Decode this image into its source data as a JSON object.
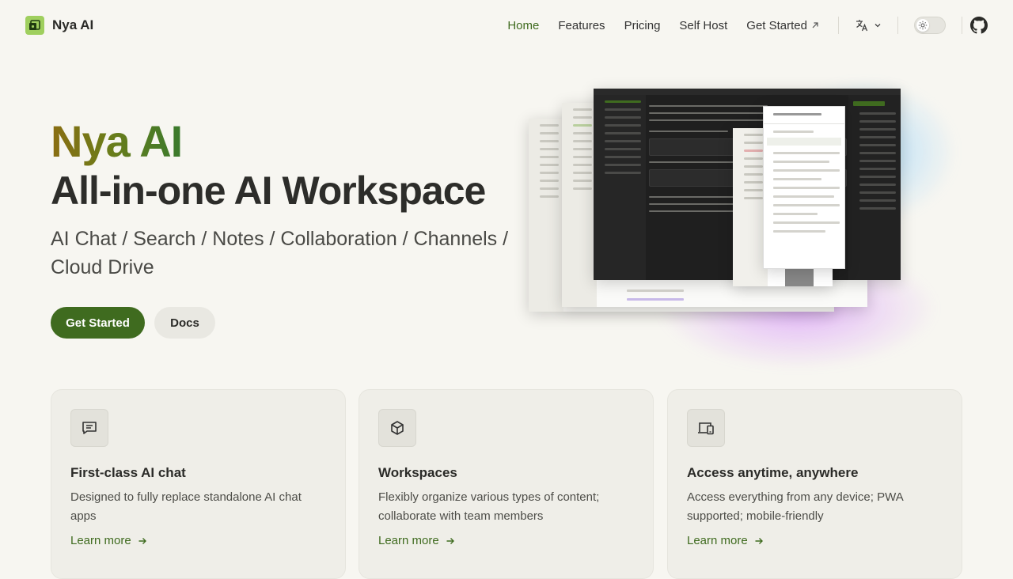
{
  "header": {
    "brand": "Nya AI",
    "nav": [
      {
        "label": "Home",
        "active": true
      },
      {
        "label": "Features"
      },
      {
        "label": "Pricing"
      },
      {
        "label": "Self Host"
      },
      {
        "label": "Get Started"
      }
    ],
    "language_icon": "translate-icon",
    "theme_icon": "sun-icon",
    "github_icon": "github-icon"
  },
  "hero": {
    "brand": "Nya AI",
    "title": "All-in-one AI Workspace",
    "subtitle": "AI Chat / Search / Notes / Collaboration / Channels / Cloud Drive",
    "primary_button": "Get Started",
    "secondary_button": "Docs"
  },
  "features": [
    {
      "icon": "chat-icon",
      "title": "First-class AI chat",
      "description": "Designed to fully replace standalone AI chat apps",
      "link": "Learn more"
    },
    {
      "icon": "cube-icon",
      "title": "Workspaces",
      "description": "Flexibly organize various types of content; collaborate with team members",
      "link": "Learn more"
    },
    {
      "icon": "devices-icon",
      "title": "Access anytime, anywhere",
      "description": "Access everything from any device; PWA supported; mobile-friendly",
      "link": "Learn more"
    }
  ],
  "colors": {
    "accent": "#3f6b1f",
    "background": "#f7f6f1",
    "card": "#efeee8"
  }
}
